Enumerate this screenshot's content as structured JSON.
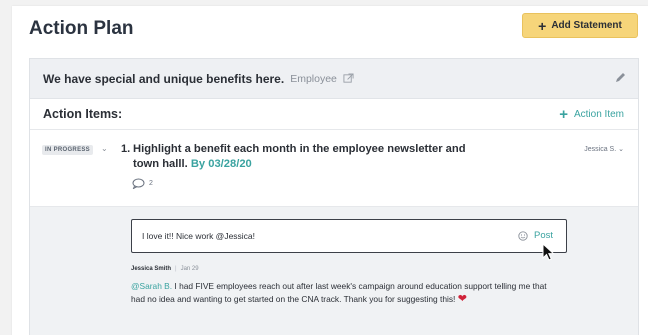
{
  "header": {
    "title": "Action Plan",
    "add_statement_label": "Add Statement"
  },
  "statement": {
    "text": "We have special and unique benefits here.",
    "tag": "Employee"
  },
  "action_items": {
    "title": "Action Items:",
    "add_label": "Action Item",
    "items": [
      {
        "status": "IN PROGRESS",
        "number": "1.",
        "text": "Highlight a benefit each month in the employee newsletter and town halll.",
        "due": "By 03/28/20",
        "assignee": "Jessica S.",
        "comment_count": "2"
      }
    ]
  },
  "comments": {
    "input_value": "I love it!! Nice work @Jessica!",
    "post_label": "Post",
    "list": [
      {
        "author": "Jessica Smith",
        "date": "Jan 29",
        "mention": "@Sarah B.",
        "body": "I had FIVE employees reach out after last week's campaign around education support telling me that had no idea and wanting to get started on the CNA track. Thank you for suggesting this!"
      }
    ]
  },
  "colors": {
    "accent": "#3aa3a0",
    "button_yellow": "#f6d57a",
    "heart": "#d0233a"
  },
  "icons": [
    "plus-icon",
    "external-link-icon",
    "pencil-icon",
    "chevron-down-icon",
    "comment-bubble-icon",
    "smiley-icon",
    "heart-icon",
    "mouse-cursor-icon"
  ]
}
